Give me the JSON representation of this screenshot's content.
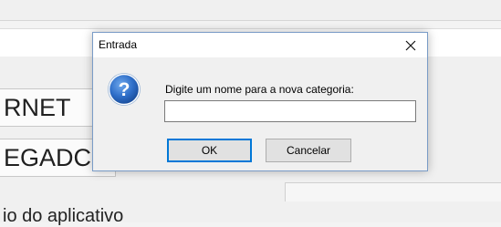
{
  "background": {
    "label_internet": "RNET",
    "label_delegados": "EGADC",
    "caption": "io do aplicativo"
  },
  "dialog": {
    "title": "Entrada",
    "close_icon": "close-icon",
    "question_icon": "question-icon",
    "prompt": "Digite um nome para a nova categoria:",
    "input_value": "",
    "ok_label": "OK",
    "cancel_label": "Cancelar"
  },
  "colors": {
    "accent": "#0078d7",
    "icon_blue": "#1f5fb8"
  }
}
